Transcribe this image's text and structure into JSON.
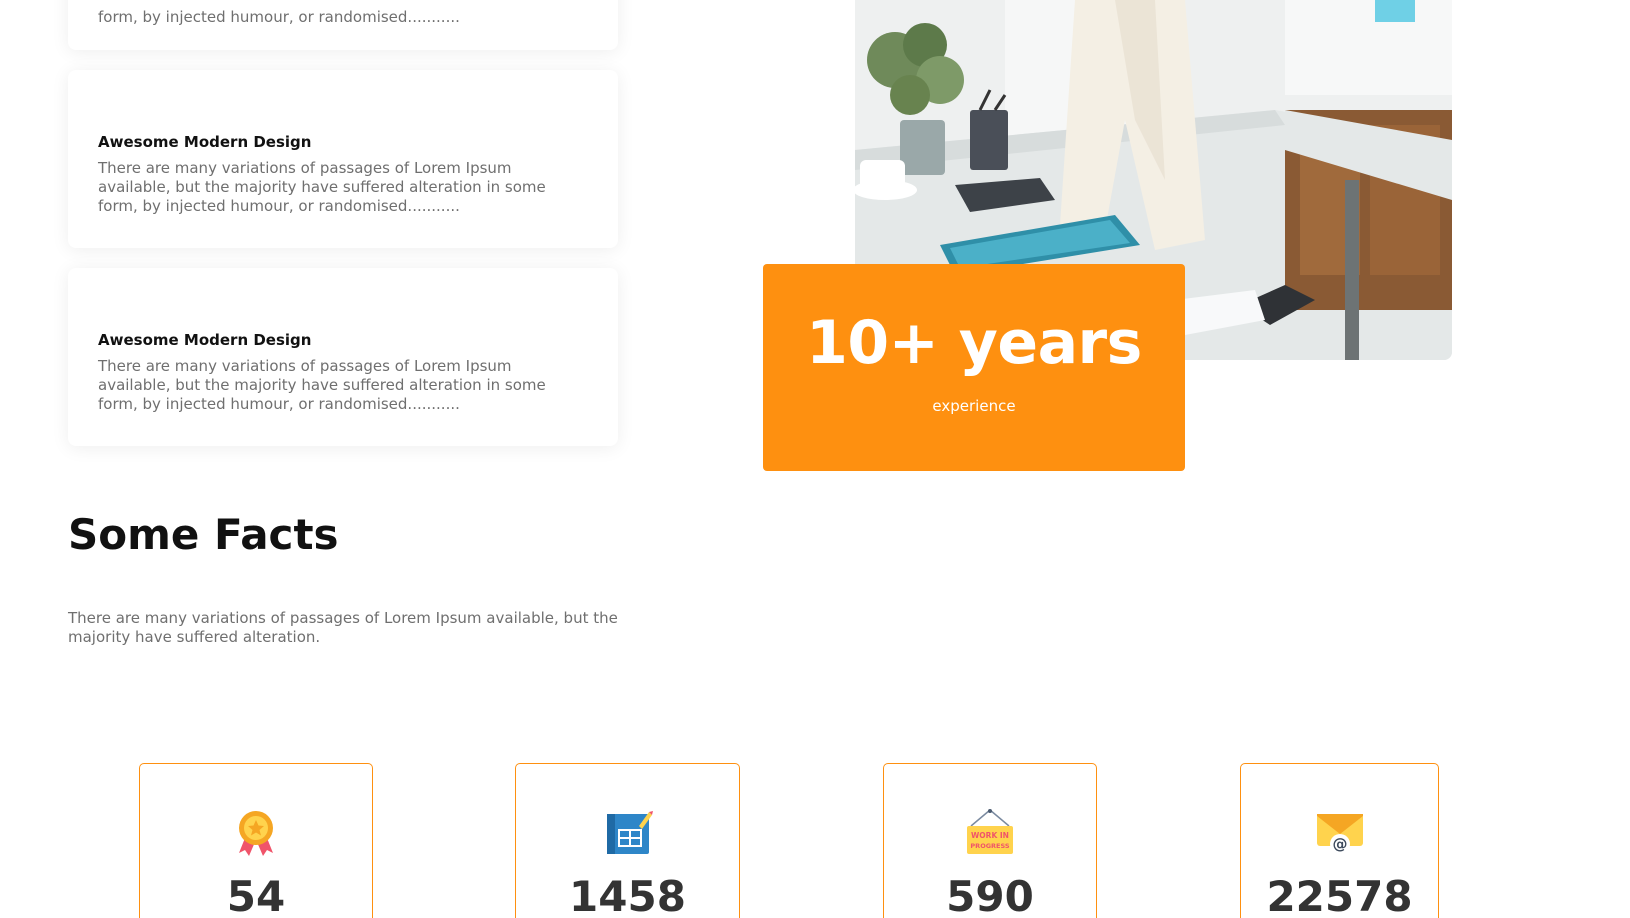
{
  "features": [
    {
      "title": "",
      "text": "form, by injected humour, or randomised..........."
    },
    {
      "title": "Awesome Modern Design",
      "text": "There are many variations of passages of Lorem Ipsum available, but the majority have suffered alteration in some form, by injected humour, or randomised..........."
    },
    {
      "title": "Awesome Modern Design",
      "text": "There are many variations of passages of Lorem Ipsum available, but the majority have suffered alteration in some form, by injected humour, or randomised..........."
    }
  ],
  "experience": {
    "headline": "10+ years",
    "label": "experience"
  },
  "facts": {
    "title": "Some Facts",
    "description": "There are many variations of passages of Lorem Ipsum available, but the majority have suffered alteration.",
    "stats": [
      {
        "icon": "award-medal-icon",
        "value": "54"
      },
      {
        "icon": "blueprint-icon",
        "value": "1458"
      },
      {
        "icon": "work-in-progress-sign-icon",
        "value": "590",
        "sign_text_1": "WORK IN",
        "sign_text_2": "PROGRESS"
      },
      {
        "icon": "email-envelope-icon",
        "value": "22578"
      }
    ]
  },
  "colors": {
    "accent": "#fe9010",
    "heading": "#111111",
    "body_text": "#6f6f6f"
  }
}
